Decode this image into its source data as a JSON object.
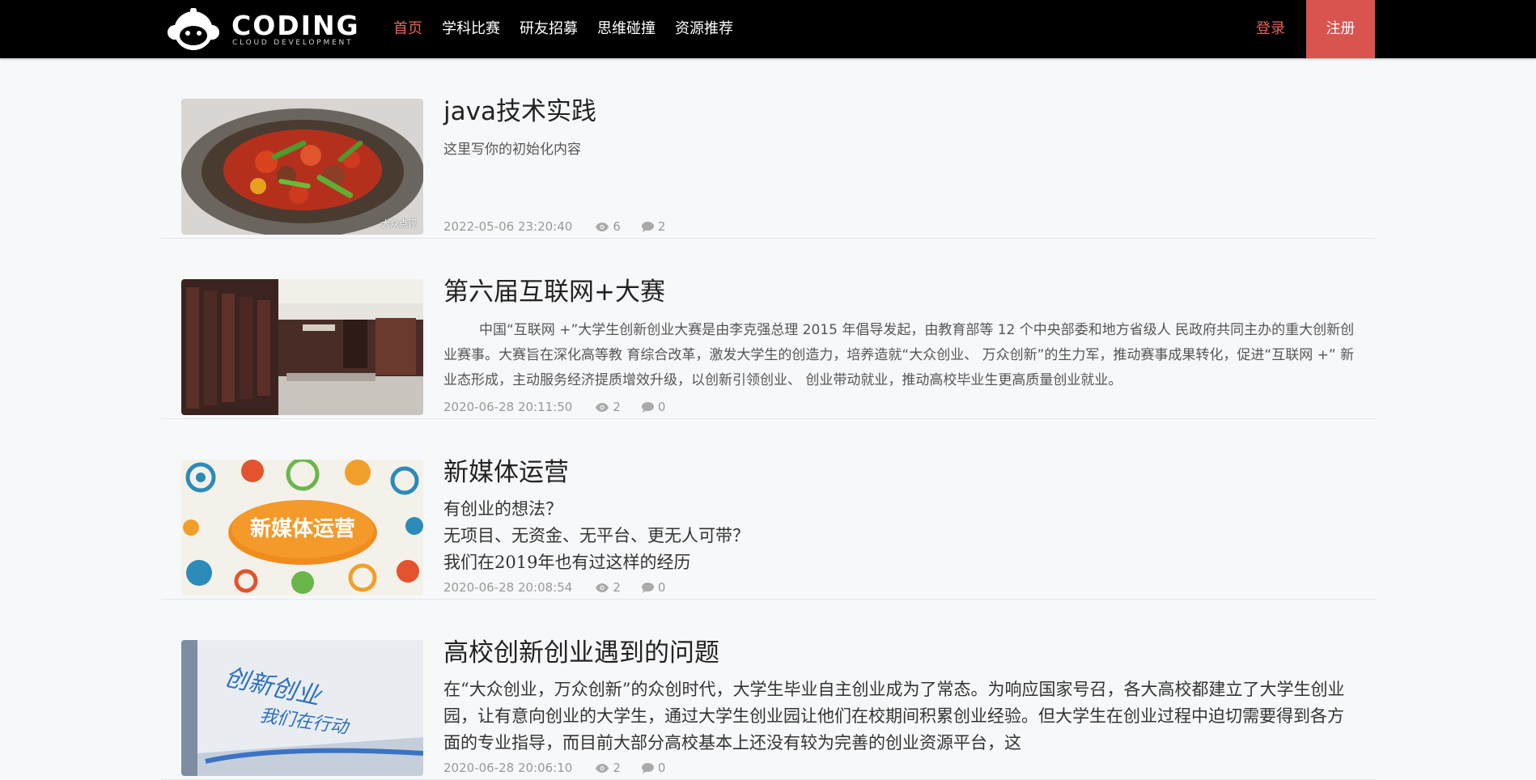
{
  "header": {
    "brand": "CODING",
    "brand_sub": "CLOUD DEVELOPMENT",
    "nav": [
      {
        "label": "首页",
        "active": true
      },
      {
        "label": "学科比赛",
        "active": false
      },
      {
        "label": "研友招募",
        "active": false
      },
      {
        "label": "思维碰撞",
        "active": false
      },
      {
        "label": "资源推荐",
        "active": false
      }
    ],
    "login": "登录",
    "register": "注册"
  },
  "colors": {
    "accent": "#e5635f",
    "register_bg": "#d9534f",
    "nav_bg": "#000000"
  },
  "articles": [
    {
      "title": "java技术实践",
      "summary": [
        "这里写你的初始化内容"
      ],
      "date": "2022-05-06 23:20:40",
      "views": "6",
      "comments": "2",
      "thumb_watermark": "大众点评",
      "thumb": "stir-fry-dish-photo"
    },
    {
      "title": "第六届互联网+大赛",
      "summary": [
        "中国“互联网 +”大学生创新创业大赛是由李克强总理 2015 年倡导发起，由教育部等 12 个中央部委和地方省级人 民政府共同主办的重大创新创业赛事。大赛旨在深化高等教 育综合改革，激发大学生的创造力，培养造就“大众创业、 万众创新”的生力军，推动赛事成果转化，促进“互联网 +” 新业态形成，主动服务经济提质增效升级，以创新引领创业、 创业带动就业，推动高校毕业生更高质量创业就业。"
      ],
      "date": "2020-06-28 20:11:50",
      "views": "2",
      "comments": "0",
      "thumb": "showroom-photo"
    },
    {
      "title": "新媒体运营",
      "summary": [
        "有创业的想法？",
        "无项目、无资金、无平台、更无人可带？",
        "我们在2019年也有过这样的经历"
      ],
      "date": "2020-06-28 20:08:54",
      "views": "2",
      "comments": "0",
      "thumb_text": "新媒体运营",
      "thumb": "new-media-illustration"
    },
    {
      "title": "高校创新创业遇到的问题",
      "summary": [
        "在“大众创业，万众创新”的众创时代，大学生毕业自主创业成为了常态。为响应国家号召，各大高校都建立了大学生创业园，让有意向创业的大学生，通过大学生创业园让他们在校期间积累创业经验。但大学生在创业过程中迫切需要得到各方面的专业指导，而目前大部分高校基本上还没有较为完善的创业资源平台，这"
      ],
      "date": "2020-06-28 20:06:10",
      "views": "2",
      "comments": "0",
      "thumb_text_1": "创新创业",
      "thumb_text_2": "我们在行动",
      "thumb": "entrepreneurship-sign-photo"
    }
  ]
}
